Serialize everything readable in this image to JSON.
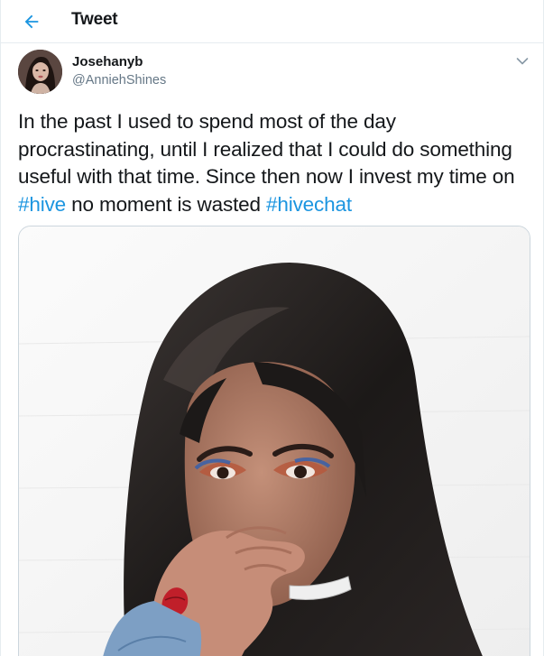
{
  "header": {
    "title": "Tweet",
    "back_icon": "arrow-left-icon"
  },
  "accent_color": "#1b95e0",
  "author": {
    "display_name": "Josehanyb",
    "handle": "@AnniehShines",
    "avatar_icon": "user-avatar"
  },
  "menu_icon": "chevron-down-icon",
  "tweet": {
    "segments": [
      {
        "text": "In the past I used to spend most of the day procrastinating, until I realized that I could do something useful with that time.  Since then now I invest my time on ",
        "type": "text"
      },
      {
        "text": "#hive",
        "type": "hashtag"
      },
      {
        "text": " no moment is wasted ",
        "type": "text"
      },
      {
        "text": "#hivechat",
        "type": "hashtag"
      }
    ]
  },
  "media": {
    "kind": "photo"
  }
}
